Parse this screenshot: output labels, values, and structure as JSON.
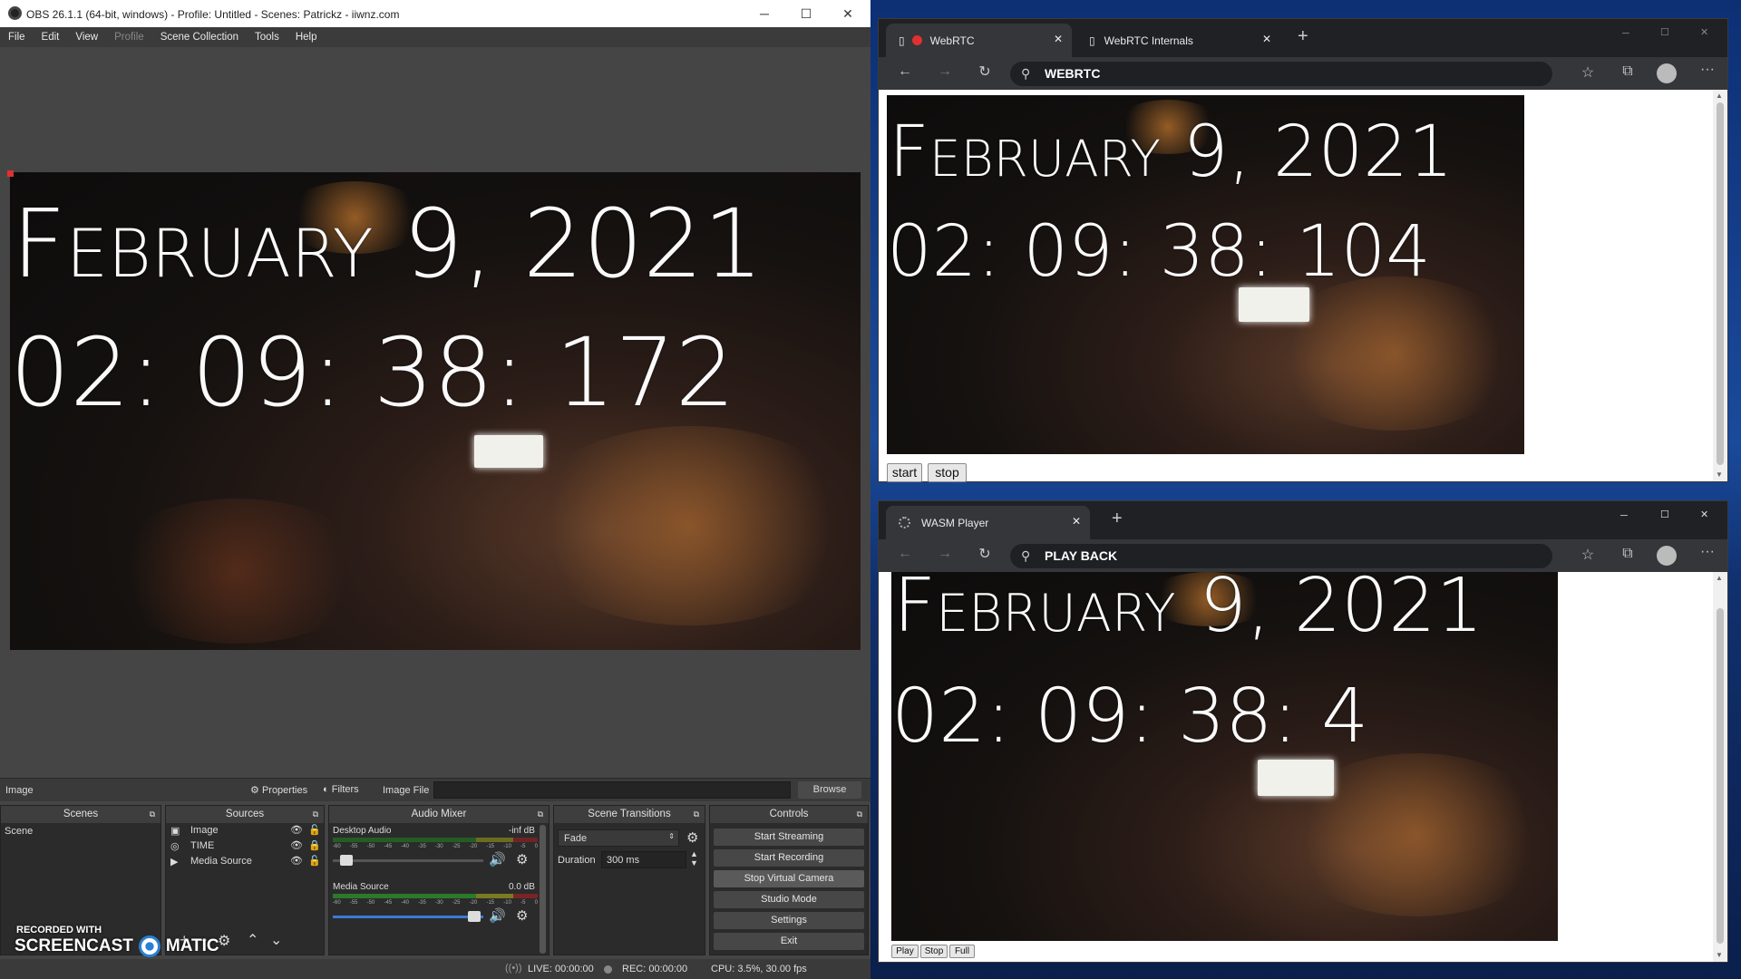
{
  "obs": {
    "title": "OBS 26.1.1 (64-bit, windows) - Profile: Untitled - Scenes: Patrickz - iiwnz.com",
    "menu": [
      "File",
      "Edit",
      "View",
      "Profile",
      "Scene Collection",
      "Tools",
      "Help"
    ],
    "preview": {
      "date": "February 9, 2021",
      "time": "02: 09: 38: 172"
    },
    "source_bar": {
      "selected": "Image",
      "properties": "Properties",
      "filters": "Filters",
      "field_label": "Image File",
      "browse": "Browse"
    },
    "scenes": {
      "header": "Scenes",
      "items": [
        "Scene"
      ]
    },
    "sources": {
      "header": "Sources",
      "items": [
        "Image",
        "TIME",
        "Media Source"
      ]
    },
    "mixer": {
      "header": "Audio Mixer",
      "channels": [
        {
          "name": "Desktop Audio",
          "level": "-inf dB",
          "volume": 0.05
        },
        {
          "name": "Media Source",
          "level": "0.0 dB",
          "volume": 0.98
        }
      ],
      "scale": [
        "-60",
        "-55",
        "-50",
        "-45",
        "-40",
        "-35",
        "-30",
        "-25",
        "-20",
        "-15",
        "-10",
        "-5",
        "0"
      ]
    },
    "transitions": {
      "header": "Scene Transitions",
      "type": "Fade",
      "duration_label": "Duration",
      "duration": "300 ms"
    },
    "controls": {
      "header": "Controls",
      "buttons": [
        "Start Streaming",
        "Start Recording",
        "Stop Virtual Camera",
        "Studio Mode",
        "Settings",
        "Exit"
      ]
    },
    "status": {
      "live": "LIVE: 00:00:00",
      "rec": "REC: 00:00:00",
      "cpu": "CPU: 3.5%, 30.00 fps"
    },
    "watermark": {
      "line1": "RECORDED WITH",
      "line2a": "SCREENCAST",
      "line2b": "MATIC"
    }
  },
  "browser1": {
    "tabs": [
      {
        "label": "WebRTC"
      },
      {
        "label": "WebRTC Internals"
      }
    ],
    "address": "WEBRTC",
    "video": {
      "date": "February 9, 2021",
      "time": "02: 09: 38: 104"
    },
    "buttons": {
      "start": "start",
      "stop": "stop"
    }
  },
  "browser2": {
    "tabs": [
      {
        "label": "WASM Player"
      }
    ],
    "address": "PLAY BACK",
    "video": {
      "date": "February 9, 2021",
      "time": "02: 09: 38: 4"
    },
    "buttons": {
      "play": "Play",
      "stop": "Stop",
      "full": "Full"
    }
  },
  "colors": {
    "obs_bg": "#454545",
    "panel_bg": "#2b2b2b",
    "edge_tab": "#353639",
    "edge_strip": "#202124",
    "record_red": "#e03030"
  }
}
